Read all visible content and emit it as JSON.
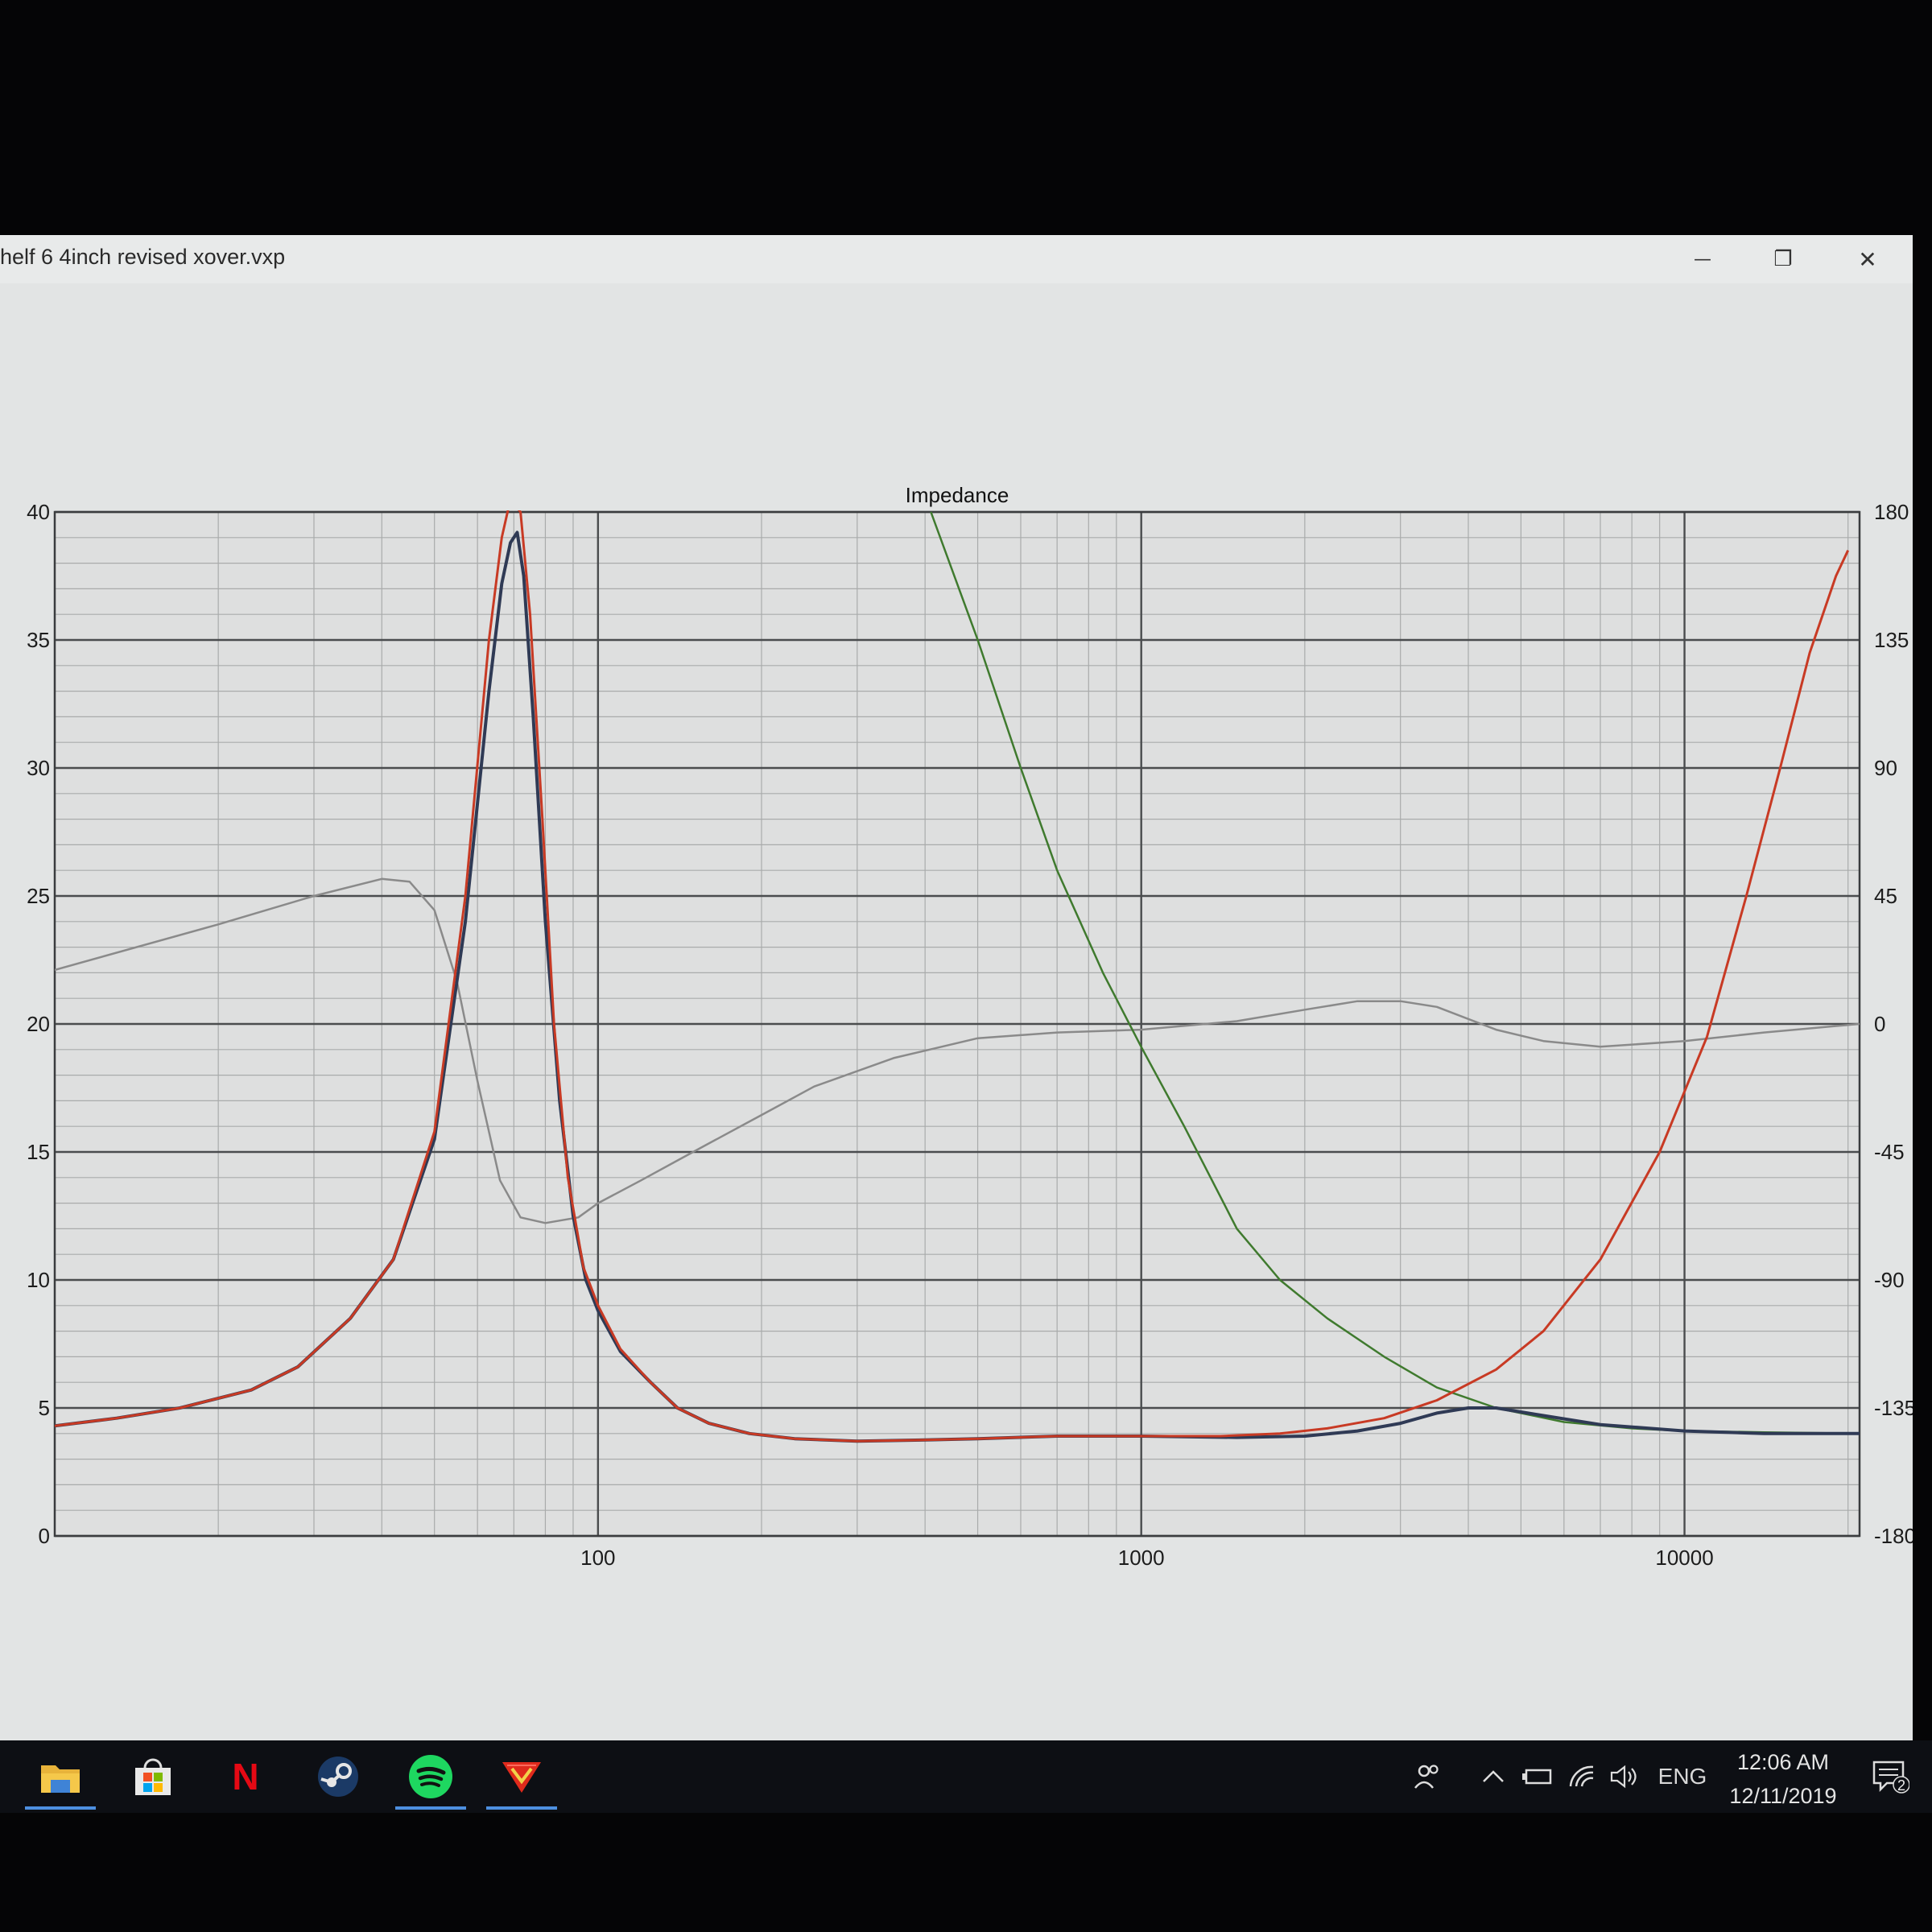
{
  "window": {
    "title": "helf 6 4inch revised xover.vxp",
    "minimize_glyph": "—",
    "restore_glyph": "❐",
    "close_glyph": "✕"
  },
  "chart_data": {
    "type": "line",
    "title": "Impedance",
    "x_scale": "log",
    "xlim": [
      10,
      21000
    ],
    "ylim_left": [
      0,
      40
    ],
    "ylim_right": [
      -180,
      180
    ],
    "x_ticks": [
      100,
      1000,
      10000
    ],
    "x_tick_labels": [
      "100",
      "1000",
      "10000"
    ],
    "y_ticks_left": [
      0,
      5,
      10,
      15,
      20,
      25,
      30,
      35,
      40
    ],
    "y_tick_labels_left": [
      "0",
      "5",
      "10",
      "15",
      "20",
      "25",
      "30",
      "35",
      "40"
    ],
    "y_ticks_right": [
      -180,
      -135,
      -90,
      -45,
      0,
      45,
      90,
      135,
      180
    ],
    "y_tick_labels_right": [
      "-180",
      "-135",
      "-90",
      "-45",
      "0",
      "45",
      "90",
      "135",
      "180"
    ],
    "grid": true,
    "legend": "none",
    "series": [
      {
        "color": "#2f3a55",
        "axis": "left",
        "width": 4,
        "points": [
          [
            10,
            4.3
          ],
          [
            13,
            4.6
          ],
          [
            17,
            5.0
          ],
          [
            23,
            5.7
          ],
          [
            28,
            6.6
          ],
          [
            35,
            8.5
          ],
          [
            42,
            10.8
          ],
          [
            50,
            15.5
          ],
          [
            57,
            24
          ],
          [
            63,
            33
          ],
          [
            66.5,
            37.2
          ],
          [
            69,
            38.8
          ],
          [
            71,
            39.2
          ],
          [
            73,
            37.5
          ],
          [
            76,
            32
          ],
          [
            80,
            24
          ],
          [
            85,
            17
          ],
          [
            90,
            12.5
          ],
          [
            95,
            10
          ],
          [
            100,
            8.8
          ],
          [
            110,
            7.2
          ],
          [
            125,
            6.0
          ],
          [
            140,
            5.0
          ],
          [
            160,
            4.4
          ],
          [
            190,
            4.0
          ],
          [
            230,
            3.8
          ],
          [
            300,
            3.7
          ],
          [
            400,
            3.75
          ],
          [
            500,
            3.8
          ],
          [
            700,
            3.9
          ],
          [
            1000,
            3.9
          ],
          [
            1500,
            3.85
          ],
          [
            2000,
            3.9
          ],
          [
            2500,
            4.1
          ],
          [
            3000,
            4.4
          ],
          [
            3500,
            4.8
          ],
          [
            4000,
            5.0
          ],
          [
            4500,
            5.0
          ],
          [
            5500,
            4.7
          ],
          [
            7000,
            4.35
          ],
          [
            10000,
            4.1
          ],
          [
            14000,
            4.0
          ],
          [
            21000,
            4.0
          ]
        ]
      },
      {
        "color": "#c83a24",
        "axis": "left",
        "width": 3,
        "points": [
          [
            10,
            4.3
          ],
          [
            13,
            4.6
          ],
          [
            17,
            5.0
          ],
          [
            23,
            5.7
          ],
          [
            28,
            6.6
          ],
          [
            35,
            8.5
          ],
          [
            42,
            10.8
          ],
          [
            50,
            15.8
          ],
          [
            57,
            25
          ],
          [
            63,
            35
          ],
          [
            66.5,
            39
          ],
          [
            69,
            40.5
          ],
          [
            72,
            40
          ],
          [
            75,
            36
          ],
          [
            79,
            28
          ],
          [
            83,
            20
          ],
          [
            88,
            14
          ],
          [
            94,
            10.5
          ],
          [
            100,
            9.0
          ],
          [
            110,
            7.3
          ],
          [
            125,
            6.0
          ],
          [
            140,
            5.0
          ],
          [
            160,
            4.4
          ],
          [
            190,
            4.0
          ],
          [
            230,
            3.8
          ],
          [
            300,
            3.7
          ],
          [
            400,
            3.75
          ],
          [
            500,
            3.8
          ],
          [
            700,
            3.9
          ],
          [
            1000,
            3.9
          ],
          [
            1400,
            3.9
          ],
          [
            1800,
            4.0
          ],
          [
            2200,
            4.2
          ],
          [
            2800,
            4.6
          ],
          [
            3500,
            5.3
          ],
          [
            4500,
            6.5
          ],
          [
            5500,
            8.0
          ],
          [
            7000,
            10.8
          ],
          [
            9000,
            15
          ],
          [
            11000,
            19.5
          ],
          [
            13000,
            25
          ],
          [
            15000,
            30
          ],
          [
            17000,
            34.5
          ],
          [
            19000,
            37.5
          ],
          [
            20000,
            38.5
          ]
        ]
      },
      {
        "color": "#3f7a2e",
        "axis": "left",
        "width": 2.5,
        "points": [
          [
            410,
            40
          ],
          [
            500,
            35
          ],
          [
            600,
            30
          ],
          [
            700,
            26
          ],
          [
            850,
            22
          ],
          [
            1000,
            19.1
          ],
          [
            1200,
            16
          ],
          [
            1500,
            12
          ],
          [
            1800,
            10
          ],
          [
            2200,
            8.5
          ],
          [
            2800,
            7.0
          ],
          [
            3500,
            5.8
          ],
          [
            4500,
            5.0
          ],
          [
            6000,
            4.45
          ],
          [
            8000,
            4.2
          ],
          [
            10000,
            4.1
          ],
          [
            14000,
            4.05
          ],
          [
            21000,
            4.0
          ]
        ]
      },
      {
        "color": "#8a8a8a",
        "axis": "right",
        "width": 2.5,
        "points": [
          [
            10,
            19
          ],
          [
            20,
            35
          ],
          [
            30,
            45
          ],
          [
            40,
            51
          ],
          [
            45,
            50
          ],
          [
            50,
            40
          ],
          [
            55,
            15
          ],
          [
            60,
            -20
          ],
          [
            66,
            -55
          ],
          [
            72,
            -68
          ],
          [
            80,
            -70
          ],
          [
            92,
            -68
          ],
          [
            100,
            -63
          ],
          [
            120,
            -55
          ],
          [
            140,
            -48
          ],
          [
            160,
            -42
          ],
          [
            200,
            -32
          ],
          [
            250,
            -22
          ],
          [
            350,
            -12
          ],
          [
            500,
            -5
          ],
          [
            700,
            -3
          ],
          [
            1000,
            -2
          ],
          [
            1500,
            1
          ],
          [
            2000,
            5
          ],
          [
            2500,
            8
          ],
          [
            3000,
            8
          ],
          [
            3500,
            6
          ],
          [
            4500,
            -2
          ],
          [
            5500,
            -6
          ],
          [
            7000,
            -8
          ],
          [
            10000,
            -6
          ],
          [
            14000,
            -3
          ],
          [
            21000,
            0
          ]
        ]
      }
    ]
  },
  "taskbar": {
    "apps": [
      {
        "name": "File Explorer",
        "icon": "folder-icon",
        "active": true
      },
      {
        "name": "Microsoft Store",
        "icon": "store-icon",
        "active": false
      },
      {
        "name": "Netflix",
        "icon": "netflix-icon",
        "glyph": "N",
        "active": false
      },
      {
        "name": "Steam",
        "icon": "steam-icon",
        "active": false
      },
      {
        "name": "Spotify",
        "icon": "spotify-icon",
        "active": true
      },
      {
        "name": "VituixCAD",
        "icon": "vituixcad-icon",
        "active": true
      }
    ],
    "language": "ENG",
    "time": "12:06 AM",
    "date": "12/11/2019",
    "notification_count": "2"
  }
}
